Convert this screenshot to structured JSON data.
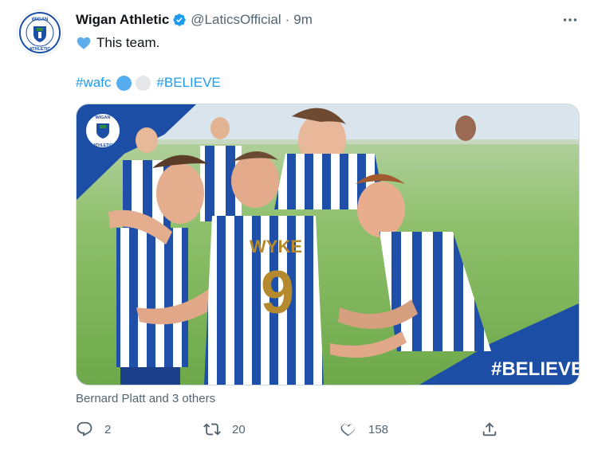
{
  "tweet": {
    "display_name": "Wigan Athletic",
    "handle": "@LaticsOfficial",
    "separator": "·",
    "time": "9m",
    "text_line1": "This team.",
    "hashtag1": "#wafc",
    "hashtag2": "#BELIEVE",
    "avatar": {
      "crest_top": "WIGAN",
      "crest_bottom": "ATHLETIC"
    },
    "media": {
      "banner_text": "#BELIEVE",
      "crest_top": "WIGAN",
      "crest_bottom": "ATHLETIC",
      "shirt_name": "WYKE",
      "shirt_number": "9",
      "brand_color": "#1c4ea6"
    },
    "liked_by": "Bernard Platt and 3 others",
    "actions": {
      "reply_count": "2",
      "retweet_count": "20",
      "like_count": "158"
    },
    "colors": {
      "verified": "#1d9bf0",
      "link": "#1d9bf0",
      "secondary": "#536471"
    }
  }
}
